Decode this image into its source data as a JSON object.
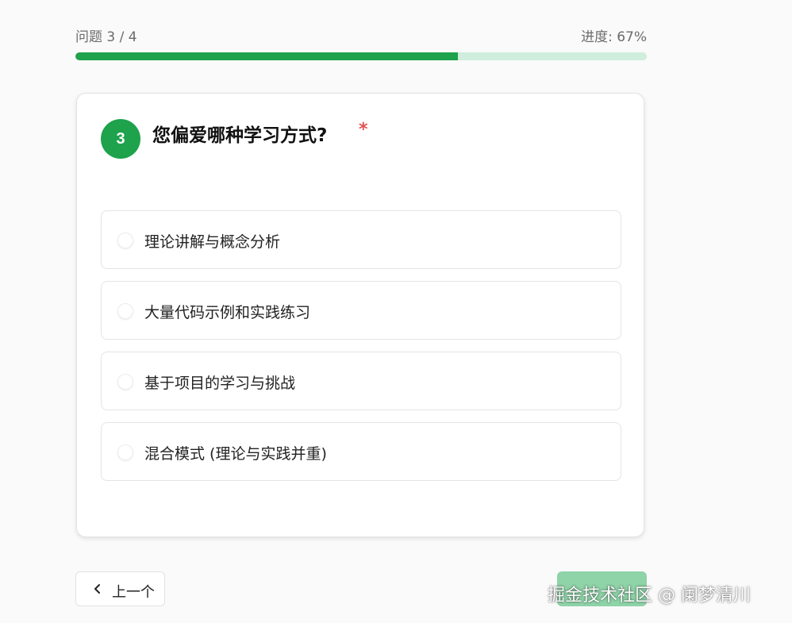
{
  "header": {
    "question_counter": "问题 3 / 4",
    "progress_label": "进度: 67%",
    "progress_value": 0.67
  },
  "question": {
    "number": "3",
    "title": "您偏爱哪种学习方式?",
    "required_mark": "*",
    "options": [
      {
        "label": "理论讲解与概念分析"
      },
      {
        "label": "大量代码示例和实践练习"
      },
      {
        "label": "基于项目的学习与挑战"
      },
      {
        "label": "混合模式 (理论与实践并重)"
      }
    ]
  },
  "nav": {
    "prev_label": "上一个",
    "next_label": ""
  },
  "watermark": "掘金技术社区 @ 阑梦清川",
  "colors": {
    "accent": "#1ea24c",
    "progress_track": "#cfeedd",
    "required": "#e05252",
    "next_disabled": "#8fd3a8"
  }
}
